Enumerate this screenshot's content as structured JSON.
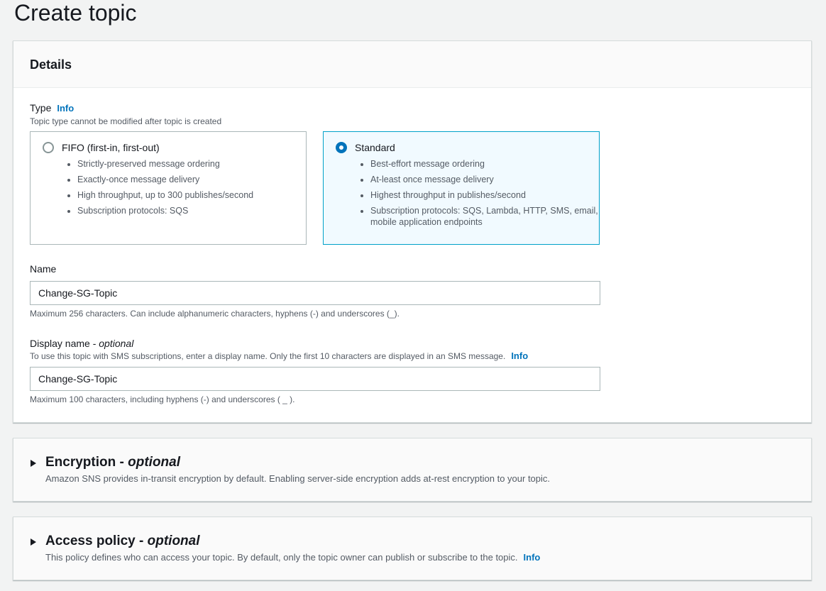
{
  "page": {
    "title": "Create topic"
  },
  "details": {
    "heading": "Details",
    "type": {
      "label": "Type",
      "info": "Info",
      "description": "Topic type cannot be modified after topic is created",
      "options": [
        {
          "title": "FIFO (first-in, first-out)",
          "selected": false,
          "bullets": [
            "Strictly-preserved message ordering",
            "Exactly-once message delivery",
            "High throughput, up to 300 publishes/second",
            "Subscription protocols: SQS"
          ]
        },
        {
          "title": "Standard",
          "selected": true,
          "bullets": [
            "Best-effort message ordering",
            "At-least once message delivery",
            "Highest throughput in publishes/second",
            "Subscription protocols: SQS, Lambda, HTTP, SMS, email, mobile application endpoints"
          ]
        }
      ]
    },
    "name": {
      "label": "Name",
      "value": "Change-SG-Topic",
      "constraint": "Maximum 256 characters. Can include alphanumeric characters, hyphens (-) and underscores (_)."
    },
    "display_name": {
      "label": "Display name - ",
      "optional": "optional",
      "description": "To use this topic with SMS subscriptions, enter a display name. Only the first 10 characters are displayed in an SMS message.",
      "info": "Info",
      "value": "Change-SG-Topic",
      "constraint": "Maximum 100 characters, including hyphens (-) and underscores ( _ )."
    }
  },
  "encryption": {
    "title": "Encryption - ",
    "optional": "optional",
    "description": "Amazon SNS provides in-transit encryption by default. Enabling server-side encryption adds at-rest encryption to your topic."
  },
  "access_policy": {
    "title": "Access policy - ",
    "optional": "optional",
    "description": "This policy defines who can access your topic. By default, only the topic owner can publish or subscribe to the topic.",
    "info": "Info"
  },
  "colors": {
    "link": "#0073bb",
    "selected_border": "#00a1c9",
    "selected_bg": "#f1faff"
  }
}
